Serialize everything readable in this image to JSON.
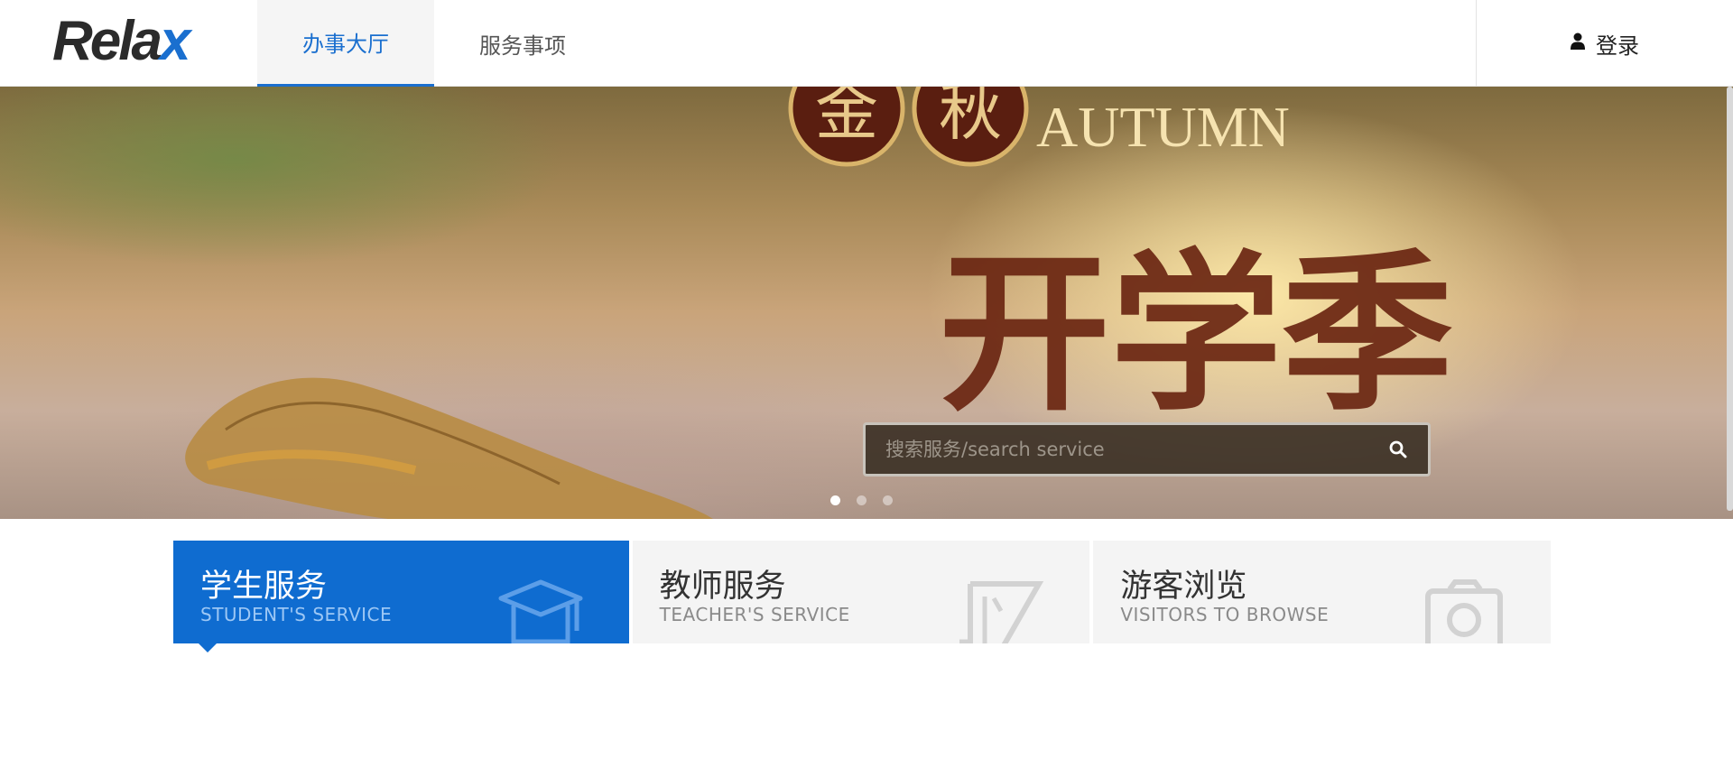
{
  "header": {
    "logo_text": "Rela",
    "logo_x": "x",
    "nav": [
      {
        "label": "办事大厅"
      },
      {
        "label": "服务事项"
      }
    ],
    "login_label": "登录",
    "login_icon": "user-icon"
  },
  "banner": {
    "caption_en": "AUTUMN",
    "badge_1": "金",
    "badge_2": "秋",
    "calligraphy": "开学季",
    "search": {
      "placeholder": "搜索服务/search service",
      "icon": "search-icon"
    },
    "slide_count": 3,
    "active_slide": 1
  },
  "services": [
    {
      "title": "学生服务",
      "subtitle": "STUDENT'S SERVICE",
      "icon": "graduation-cap-icon",
      "active": true
    },
    {
      "title": "教师服务",
      "subtitle": "TEACHER'S SERVICE",
      "icon": "pencil-ruler-icon",
      "active": false
    },
    {
      "title": "游客浏览",
      "subtitle": "VISITORS TO BROWSE",
      "icon": "camera-icon",
      "active": false
    }
  ],
  "colors": {
    "accent": "#0f6cd0",
    "card_bg": "#f4f4f4",
    "search_bg": "#3a2f23"
  }
}
